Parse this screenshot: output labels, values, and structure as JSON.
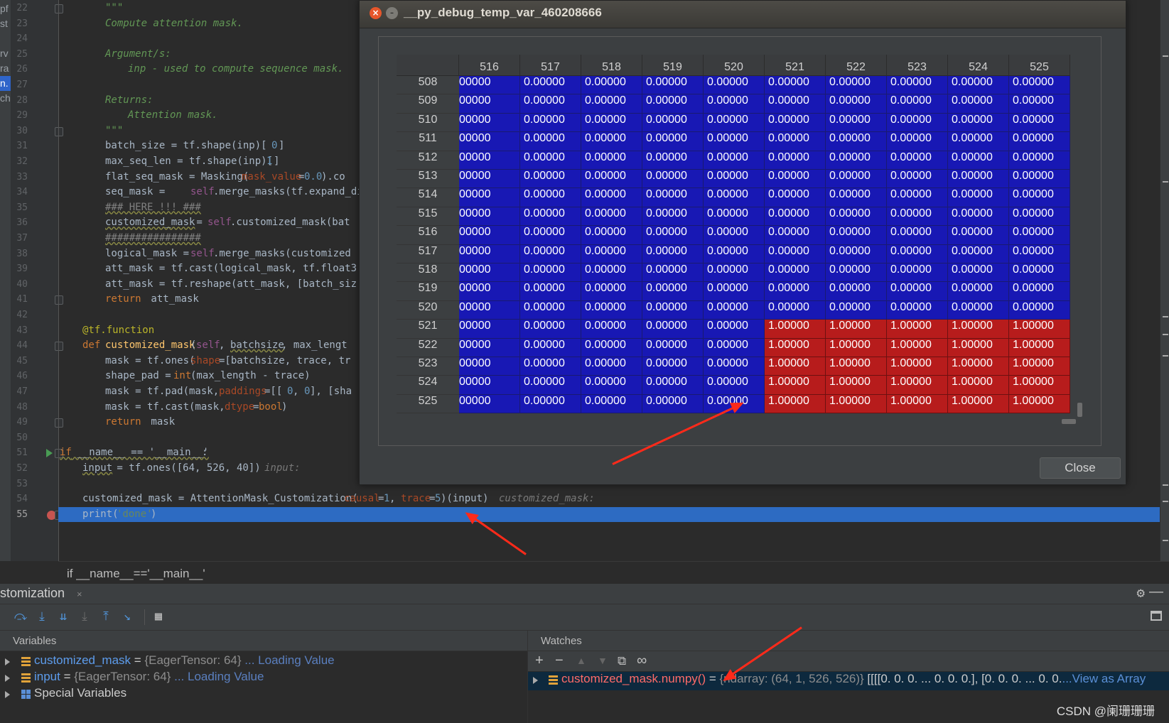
{
  "left_strip": [
    "pf",
    "st",
    "",
    "rv",
    "ra",
    "n.",
    "ch"
  ],
  "editor": {
    "line_numbers": [
      "22",
      "23",
      "24",
      "25",
      "26",
      "27",
      "28",
      "29",
      "30",
      "31",
      "32",
      "33",
      "34",
      "35",
      "36",
      "37",
      "38",
      "39",
      "40",
      "41",
      "42",
      "43",
      "44",
      "45",
      "46",
      "47",
      "48",
      "49",
      "50",
      "51",
      "52",
      "53",
      "54",
      "55"
    ],
    "current_line": "55",
    "breadcrumb": "if __name__=='__main__'"
  },
  "code_tokens": [
    [
      [
        148,
        "doc",
        "\"\"\""
      ]
    ],
    [
      [
        148,
        "doc",
        "Compute attention mask."
      ]
    ],
    [],
    [
      [
        148,
        "doc",
        "Argument/s:"
      ]
    ],
    [
      [
        180,
        "doc",
        "inp - used to compute sequence mask."
      ]
    ],
    [],
    [
      [
        148,
        "doc",
        "Returns:"
      ]
    ],
    [
      [
        180,
        "doc",
        "Attention mask."
      ]
    ],
    [
      [
        148,
        "doc",
        "\"\"\""
      ]
    ],
    [
      [
        148,
        "",
        "batch_size = tf.shape(inp)["
      ],
      [
        382,
        "num",
        "0"
      ],
      [
        392,
        "",
        "]"
      ]
    ],
    [
      [
        148,
        "",
        "max_seq_len = tf.shape(inp)["
      ],
      [
        375,
        "num",
        "1"
      ],
      [
        385,
        "",
        "]"
      ]
    ],
    [
      [
        148,
        "",
        "flat_seq_mask = Masking("
      ],
      [
        340,
        "prm",
        "mask_value"
      ],
      [
        420,
        "",
        "="
      ],
      [
        428,
        "num",
        "0.0"
      ],
      [
        452,
        "",
        ").co"
      ]
    ],
    [
      [
        148,
        "",
        "seq_mask = "
      ],
      [
        268,
        "self",
        "self"
      ],
      [
        300,
        "",
        ".merge_masks(tf.expand_dims"
      ]
    ],
    [
      [
        148,
        "cmt sq",
        "### HERE !!! ###"
      ]
    ],
    [
      [
        148,
        "sq",
        "customized_mask"
      ],
      [
        268,
        "",
        " = "
      ],
      [
        292,
        "self",
        "self"
      ],
      [
        324,
        "",
        ".customized_mask(bat"
      ]
    ],
    [
      [
        148,
        "cmt sq",
        "################"
      ]
    ],
    [
      [
        148,
        "",
        "logical_mask = "
      ],
      [
        268,
        "self",
        "self"
      ],
      [
        300,
        "",
        ".merge_masks(customized"
      ]
    ],
    [
      [
        148,
        "",
        "att_mask = tf.cast(logical_mask, tf.float3"
      ]
    ],
    [
      [
        148,
        "",
        "att_mask = tf.reshape(att_mask, [batch_siz"
      ]
    ],
    [
      [
        148,
        "kw",
        "return"
      ],
      [
        204,
        "",
        " att_mask"
      ]
    ],
    [],
    [
      [
        116,
        "dec",
        "@tf.function"
      ]
    ],
    [
      [
        116,
        "kw",
        "def"
      ],
      [
        148,
        "fn",
        "customized_mask"
      ],
      [
        268,
        "",
        "("
      ],
      [
        276,
        "self",
        "self"
      ],
      [
        308,
        "",
        ", "
      ],
      [
        324,
        "sq",
        "batchsize"
      ],
      [
        396,
        "",
        ", max_lengt"
      ]
    ],
    [
      [
        148,
        "",
        "mask = tf.ones("
      ],
      [
        268,
        "prm",
        "shape"
      ],
      [
        308,
        "",
        "=[batchsize, trace, tr"
      ]
    ],
    [
      [
        148,
        "",
        "shape_pad = "
      ],
      [
        244,
        "kw",
        "int"
      ],
      [
        268,
        "",
        "(max_length - trace)"
      ]
    ],
    [
      [
        148,
        "",
        "mask = tf.pad(mask, "
      ],
      [
        308,
        "prm",
        "paddings"
      ],
      [
        372,
        "",
        "=[["
      ],
      [
        404,
        "num",
        "0"
      ],
      [
        412,
        "",
        ", "
      ],
      [
        428,
        "num",
        "0"
      ],
      [
        436,
        "",
        "], [sha"
      ]
    ],
    [
      [
        148,
        "",
        "mask = tf.cast(mask, "
      ],
      [
        316,
        "prm",
        "dtype"
      ],
      [
        356,
        "",
        "="
      ],
      [
        364,
        "kw",
        "bool"
      ],
      [
        396,
        "",
        ")"
      ]
    ],
    [
      [
        148,
        "kw",
        "return"
      ],
      [
        204,
        "",
        " mask"
      ]
    ],
    [],
    [
      [
        84,
        "kw sq",
        "if"
      ],
      [
        100,
        "sq",
        " __name__ == '__main__'"
      ],
      [
        284,
        "",
        ":"
      ]
    ],
    [
      [
        116,
        "sq",
        "input"
      ],
      [
        156,
        "",
        " = tf.ones([64, 526, 40])"
      ],
      [
        372,
        "hint",
        "input:"
      ]
    ],
    [],
    [
      [
        116,
        "",
        "customized_mask = AttentionMask_Customization("
      ],
      [
        484,
        "prm",
        "causal"
      ],
      [
        532,
        "",
        "="
      ],
      [
        540,
        "num",
        "1"
      ],
      [
        548,
        "",
        ", "
      ],
      [
        564,
        "prm",
        "trace"
      ],
      [
        604,
        "",
        "="
      ],
      [
        612,
        "num",
        "5"
      ],
      [
        620,
        "",
        ")(input)"
      ],
      [
        702,
        "hint",
        "customized_mask:"
      ]
    ],
    [
      [
        116,
        "",
        "print("
      ],
      [
        164,
        "str",
        "'done'"
      ],
      [
        212,
        "",
        ")"
      ]
    ]
  ],
  "debugger": {
    "session_title": "stomization",
    "close_x": "×",
    "toolbar_icons": [
      "step-over-icon",
      "step-into-icon",
      "step-into-my-code-icon",
      "force-step-into-icon",
      "step-out-icon",
      "run-to-cursor-icon",
      "evaluate-expression-icon"
    ],
    "variables_header": "Variables",
    "watches_header": "Watches",
    "variables": [
      {
        "name": "customized_mask",
        "value": "{EagerTensor: 64}",
        "loading": "... Loading Value"
      },
      {
        "name": "input",
        "value": "{EagerTensor: 64}",
        "loading": "... Loading Value"
      },
      {
        "name": "Special Variables",
        "value": "",
        "loading": ""
      }
    ],
    "watch": {
      "name": "customized_mask.numpy()",
      "eq": " = ",
      "type": "{ndarray: (64, 1, 526, 526)}",
      "value": " [[[[0. 0. 0. ... 0. 0. 0.],  [0. 0. 0. ... 0. 0.",
      "link": "...View as Array"
    },
    "watch_toolbar": {
      "add": "+",
      "remove": "−",
      "up": "▲",
      "down": "▼",
      "copy": "⧉",
      "glasses": "∞"
    }
  },
  "dialog": {
    "title": "__py_debug_temp_var_460208666",
    "close_button": "Close",
    "columns": [
      "516",
      "517",
      "518",
      "519",
      "520",
      "521",
      "522",
      "523",
      "524",
      "525"
    ],
    "rows": [
      "508",
      "509",
      "510",
      "511",
      "512",
      "513",
      "514",
      "515",
      "516",
      "517",
      "518",
      "519",
      "520",
      "521",
      "522",
      "523",
      "524",
      "525"
    ],
    "matrix": [
      [
        "00000",
        "0.00000",
        "0.00000",
        "0.00000",
        "0.00000",
        "0.00000",
        "0.00000",
        "0.00000",
        "0.00000",
        "0.00000"
      ],
      [
        "00000",
        "0.00000",
        "0.00000",
        "0.00000",
        "0.00000",
        "0.00000",
        "0.00000",
        "0.00000",
        "0.00000",
        "0.00000"
      ],
      [
        "00000",
        "0.00000",
        "0.00000",
        "0.00000",
        "0.00000",
        "0.00000",
        "0.00000",
        "0.00000",
        "0.00000",
        "0.00000"
      ],
      [
        "00000",
        "0.00000",
        "0.00000",
        "0.00000",
        "0.00000",
        "0.00000",
        "0.00000",
        "0.00000",
        "0.00000",
        "0.00000"
      ],
      [
        "00000",
        "0.00000",
        "0.00000",
        "0.00000",
        "0.00000",
        "0.00000",
        "0.00000",
        "0.00000",
        "0.00000",
        "0.00000"
      ],
      [
        "00000",
        "0.00000",
        "0.00000",
        "0.00000",
        "0.00000",
        "0.00000",
        "0.00000",
        "0.00000",
        "0.00000",
        "0.00000"
      ],
      [
        "00000",
        "0.00000",
        "0.00000",
        "0.00000",
        "0.00000",
        "0.00000",
        "0.00000",
        "0.00000",
        "0.00000",
        "0.00000"
      ],
      [
        "00000",
        "0.00000",
        "0.00000",
        "0.00000",
        "0.00000",
        "0.00000",
        "0.00000",
        "0.00000",
        "0.00000",
        "0.00000"
      ],
      [
        "00000",
        "0.00000",
        "0.00000",
        "0.00000",
        "0.00000",
        "0.00000",
        "0.00000",
        "0.00000",
        "0.00000",
        "0.00000"
      ],
      [
        "00000",
        "0.00000",
        "0.00000",
        "0.00000",
        "0.00000",
        "0.00000",
        "0.00000",
        "0.00000",
        "0.00000",
        "0.00000"
      ],
      [
        "00000",
        "0.00000",
        "0.00000",
        "0.00000",
        "0.00000",
        "0.00000",
        "0.00000",
        "0.00000",
        "0.00000",
        "0.00000"
      ],
      [
        "00000",
        "0.00000",
        "0.00000",
        "0.00000",
        "0.00000",
        "0.00000",
        "0.00000",
        "0.00000",
        "0.00000",
        "0.00000"
      ],
      [
        "00000",
        "0.00000",
        "0.00000",
        "0.00000",
        "0.00000",
        "0.00000",
        "0.00000",
        "0.00000",
        "0.00000",
        "0.00000"
      ],
      [
        "00000",
        "0.00000",
        "0.00000",
        "0.00000",
        "0.00000",
        "1.00000",
        "1.00000",
        "1.00000",
        "1.00000",
        "1.00000"
      ],
      [
        "00000",
        "0.00000",
        "0.00000",
        "0.00000",
        "0.00000",
        "1.00000",
        "1.00000",
        "1.00000",
        "1.00000",
        "1.00000"
      ],
      [
        "00000",
        "0.00000",
        "0.00000",
        "0.00000",
        "0.00000",
        "1.00000",
        "1.00000",
        "1.00000",
        "1.00000",
        "1.00000"
      ],
      [
        "00000",
        "0.00000",
        "0.00000",
        "0.00000",
        "0.00000",
        "1.00000",
        "1.00000",
        "1.00000",
        "1.00000",
        "1.00000"
      ],
      [
        "00000",
        "0.00000",
        "0.00000",
        "0.00000",
        "0.00000",
        "1.00000",
        "1.00000",
        "1.00000",
        "1.00000",
        "1.00000"
      ]
    ],
    "colors": {
      "zero": "#1818b4",
      "one": "#b71c1c"
    }
  },
  "watermark": "CSDN @阑珊珊珊"
}
